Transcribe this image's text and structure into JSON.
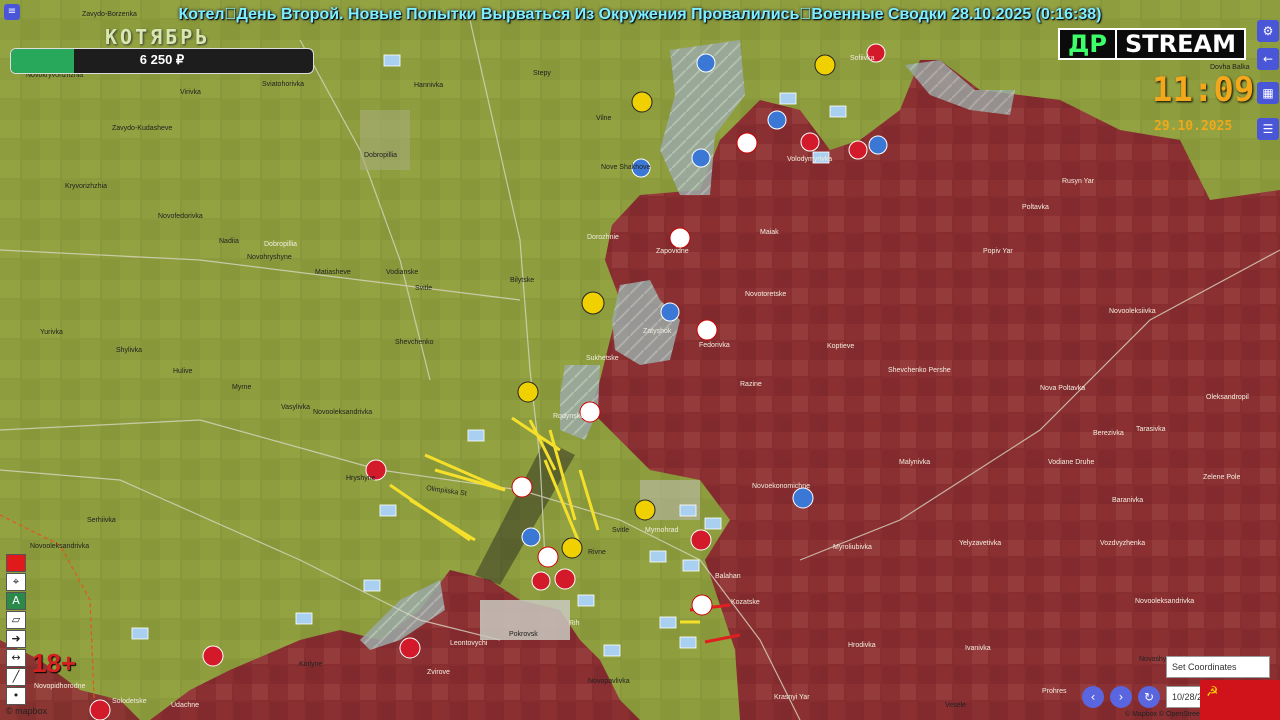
{
  "header": {
    "title": "Котел\u0000День Второй. Новые Попытки Вырваться Из Окружения Провалились\u0000Военные Сводки 28.10.2025 (0:16:38)",
    "month": "КОТЯБРЬ",
    "donation": {
      "amount": "6 250 ₽",
      "progress": 0.21
    },
    "logo_left": "ДР",
    "logo_right": "STREAM",
    "clock": "11:09",
    "date": "29.10.2025"
  },
  "colors": {
    "ua_bg": "#8a9a3a",
    "ru_zone": "#8c2630",
    "contested": "#9aa6a4",
    "arrow_ua": "#f5df2a",
    "arrow_ru": "#e02020",
    "accent": "#4a56d8"
  },
  "places": [
    {
      "name": "Zavydo-Borzenka"
    },
    {
      "name": "Novokryvorizhzhia"
    },
    {
      "name": "Virivka"
    },
    {
      "name": "Sviatohorivka"
    },
    {
      "name": "Hannivka"
    },
    {
      "name": "Stepy"
    },
    {
      "name": "Sofiivka"
    },
    {
      "name": "Dovha Balka"
    },
    {
      "name": "Zavydo-Kudasheve"
    },
    {
      "name": "Dobropillia"
    },
    {
      "name": "Vilne"
    },
    {
      "name": "Nove Shakhove"
    },
    {
      "name": "Volodymyrivka"
    },
    {
      "name": "Rusyn Yar"
    },
    {
      "name": "Poltavka"
    },
    {
      "name": "Kryvorizhzhia"
    },
    {
      "name": "Novofedorivka"
    },
    {
      "name": "Nadiia"
    },
    {
      "name": "Dobropillia"
    },
    {
      "name": "Dorozhnie"
    },
    {
      "name": "Maiak"
    },
    {
      "name": "Zapovidne"
    },
    {
      "name": "Popiv Yar"
    },
    {
      "name": "Novohryshyne"
    },
    {
      "name": "Matiasheve"
    },
    {
      "name": "Vodianske"
    },
    {
      "name": "Svitle"
    },
    {
      "name": "Bilytske"
    },
    {
      "name": "Novotoretske"
    },
    {
      "name": "Zatyshok"
    },
    {
      "name": "Novooleksiivka"
    },
    {
      "name": "Yurivka"
    },
    {
      "name": "Shylivka"
    },
    {
      "name": "Shevchenko"
    },
    {
      "name": "Sukhetske"
    },
    {
      "name": "Fedorivka"
    },
    {
      "name": "Koptieve"
    },
    {
      "name": "Hulive"
    },
    {
      "name": "Myrne"
    },
    {
      "name": "Razine"
    },
    {
      "name": "Shevchenko Pershe"
    },
    {
      "name": "Nova Poltavka"
    },
    {
      "name": "Vasylivka"
    },
    {
      "name": "Novooleksandrivka"
    },
    {
      "name": "Rodynske"
    },
    {
      "name": "Oleksandropil"
    },
    {
      "name": "Berezivka"
    },
    {
      "name": "Tarasivka"
    },
    {
      "name": "Malynivka"
    },
    {
      "name": "Vodiane Druhe"
    },
    {
      "name": "Hryshyne"
    },
    {
      "name": "Novoekonomichne"
    },
    {
      "name": "Zelene Pole"
    },
    {
      "name": "Baranivka"
    },
    {
      "name": "Serhiivka"
    },
    {
      "name": "Svitle"
    },
    {
      "name": "Myrnohrad"
    },
    {
      "name": "Novooleksandrivka"
    },
    {
      "name": "Rivne"
    },
    {
      "name": "Myroliubivka"
    },
    {
      "name": "Yelyzavetivka"
    },
    {
      "name": "Vozdvyzhenka"
    },
    {
      "name": "Balahan"
    },
    {
      "name": "Kozatske"
    },
    {
      "name": "Novooleksandrivka"
    },
    {
      "name": "Pokrovsk"
    },
    {
      "name": "Rih"
    },
    {
      "name": "Leontovychi"
    },
    {
      "name": "Hrodivka"
    },
    {
      "name": "Ivanivka"
    },
    {
      "name": "Novoshyrokel"
    },
    {
      "name": "Zvirove"
    },
    {
      "name": "Kotlyne"
    },
    {
      "name": "Novopidhorodne"
    },
    {
      "name": "Novopavlivka"
    },
    {
      "name": "Krasnyi Yar"
    },
    {
      "name": "Prohres"
    },
    {
      "name": "Udachne"
    },
    {
      "name": "Vesele"
    },
    {
      "name": "Solodetske"
    }
  ],
  "street_label": "Olimpiiska St",
  "tools": {
    "age_rating": "18+",
    "coord_button": "Set Coordinates",
    "date_input": "10/28/2",
    "attribution": "© mapbox",
    "map_credit": "© Mapbox © OpenStreetMap"
  },
  "icons": [
    "menu-icon",
    "settings-icon",
    "arrow-left-icon",
    "layers-icon",
    "list-icon",
    "link-icon"
  ],
  "flag": {
    "symbol": "☭"
  }
}
